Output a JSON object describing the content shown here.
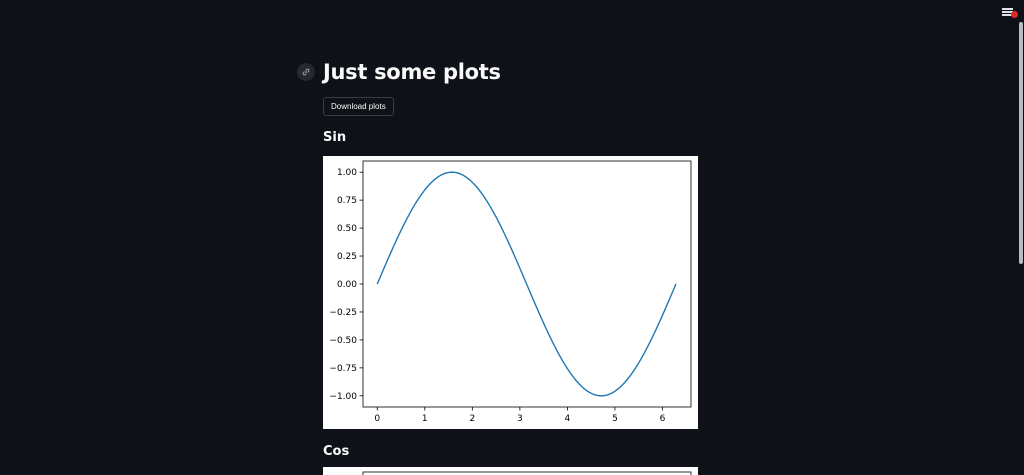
{
  "header": {
    "title": "Just some plots",
    "download_label": "Download plots"
  },
  "sections": [
    {
      "title": "Sin"
    },
    {
      "title": "Cos"
    }
  ],
  "chart_data": [
    {
      "type": "line",
      "title": "",
      "xlabel": "",
      "ylabel": "",
      "function": "sin(x)",
      "series": [
        {
          "color": "#1f77b4",
          "x": [
            0,
            0.3,
            0.6,
            0.9,
            1.2,
            1.5708,
            1.8,
            2.1,
            2.4,
            2.7,
            3.0,
            3.1416,
            3.3,
            3.6,
            3.9,
            4.2,
            4.5,
            4.7124,
            5.0,
            5.3,
            5.6,
            5.9,
            6.2832
          ],
          "y": [
            0,
            0.2955,
            0.5646,
            0.7833,
            0.932,
            1.0,
            0.9738,
            0.8632,
            0.6755,
            0.4274,
            0.1411,
            0,
            -0.1577,
            -0.4425,
            -0.6878,
            -0.8716,
            -0.9775,
            -1.0,
            -0.9589,
            -0.8323,
            -0.6313,
            -0.3739,
            0
          ]
        }
      ],
      "xlim": [
        -0.3,
        6.6
      ],
      "ylim": [
        -1.1,
        1.1
      ],
      "x_ticks": [
        "0",
        "1",
        "2",
        "3",
        "4",
        "5",
        "6"
      ],
      "y_ticks": [
        "1.00",
        "0.75",
        "0.50",
        "0.25",
        "0.00",
        "−0.25",
        "−0.50",
        "−0.75",
        "−1.00"
      ],
      "grid": false
    }
  ]
}
